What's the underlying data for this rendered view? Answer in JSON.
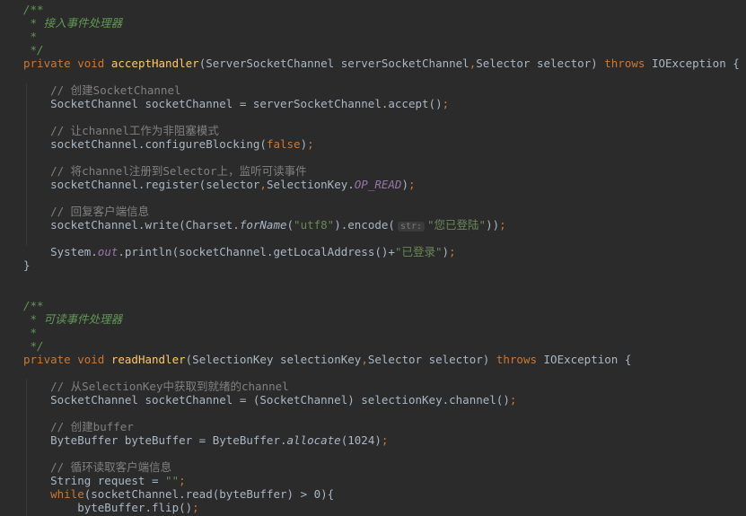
{
  "code": {
    "lines": [
      [
        {
          "t": "/**",
          "c": "doc"
        }
      ],
      [
        {
          "t": " * 接入事件处理器",
          "c": "doc"
        }
      ],
      [
        {
          "t": " *",
          "c": "doc"
        }
      ],
      [
        {
          "t": " */",
          "c": "doc"
        }
      ],
      [
        {
          "t": "private void ",
          "c": "kw"
        },
        {
          "t": "acceptHandler",
          "c": "fn"
        },
        {
          "t": "(ServerSocketChannel serverSocketChannel",
          "c": "p"
        },
        {
          "t": ",",
          "c": "kw"
        },
        {
          "t": "Selector selector) ",
          "c": "p"
        },
        {
          "t": "throws ",
          "c": "kw"
        },
        {
          "t": "IOException {",
          "c": "p"
        }
      ],
      [],
      [
        {
          "t": "    // 创建SocketChannel",
          "c": "cmt"
        }
      ],
      [
        {
          "t": "    SocketChannel socketChannel = serverSocketChannel.accept()",
          "c": "p"
        },
        {
          "t": ";",
          "c": "kw"
        }
      ],
      [],
      [
        {
          "t": "    // 让channel工作为非阻塞模式",
          "c": "cmt"
        }
      ],
      [
        {
          "t": "    socketChannel.configureBlocking(",
          "c": "p"
        },
        {
          "t": "false",
          "c": "kw"
        },
        {
          "t": ")",
          "c": "p"
        },
        {
          "t": ";",
          "c": "kw"
        }
      ],
      [],
      [
        {
          "t": "    // 将channel注册到Selector上，监听可读事件",
          "c": "cmt"
        }
      ],
      [
        {
          "t": "    socketChannel.register(selector",
          "c": "p"
        },
        {
          "t": ",",
          "c": "kw"
        },
        {
          "t": "SelectionKey.",
          "c": "p"
        },
        {
          "t": "OP_READ",
          "c": "st"
        },
        {
          "t": ")",
          "c": "p"
        },
        {
          "t": ";",
          "c": "kw"
        }
      ],
      [],
      [
        {
          "t": "    // 回复客户端信息",
          "c": "cmt"
        }
      ],
      [
        {
          "t": "    socketChannel.write(Charset.",
          "c": "p"
        },
        {
          "t": "forName",
          "c": "sm"
        },
        {
          "t": "(",
          "c": "p"
        },
        {
          "t": "\"utf8\"",
          "c": "str"
        },
        {
          "t": ").encode(",
          "c": "p"
        },
        {
          "t": "str:",
          "c": "hint"
        },
        {
          "t": "\"您已登陆\"",
          "c": "str"
        },
        {
          "t": "))",
          "c": "p"
        },
        {
          "t": ";",
          "c": "kw"
        }
      ],
      [],
      [
        {
          "t": "    System.",
          "c": "p"
        },
        {
          "t": "out",
          "c": "st"
        },
        {
          "t": ".println(socketChannel.getLocalAddress()+",
          "c": "p"
        },
        {
          "t": "\"已登录\"",
          "c": "str"
        },
        {
          "t": ")",
          "c": "p"
        },
        {
          "t": ";",
          "c": "kw"
        }
      ],
      [
        {
          "t": "}",
          "c": "p"
        }
      ],
      [],
      [],
      [
        {
          "t": "/**",
          "c": "doc"
        }
      ],
      [
        {
          "t": " * 可读事件处理器",
          "c": "doc"
        }
      ],
      [
        {
          "t": " *",
          "c": "doc"
        }
      ],
      [
        {
          "t": " */",
          "c": "doc"
        }
      ],
      [
        {
          "t": "private void ",
          "c": "kw"
        },
        {
          "t": "readHandler",
          "c": "fn"
        },
        {
          "t": "(SelectionKey selectionKey",
          "c": "p"
        },
        {
          "t": ",",
          "c": "kw"
        },
        {
          "t": "Selector selector) ",
          "c": "p"
        },
        {
          "t": "throws ",
          "c": "kw"
        },
        {
          "t": "IOException {",
          "c": "p"
        }
      ],
      [],
      [
        {
          "t": "    // 从SelectionKey中获取到就绪的channel",
          "c": "cmt"
        }
      ],
      [
        {
          "t": "    SocketChannel socketChannel = (SocketChannel) selectionKey.channel()",
          "c": "p"
        },
        {
          "t": ";",
          "c": "kw"
        }
      ],
      [],
      [
        {
          "t": "    // 创建buffer",
          "c": "cmt"
        }
      ],
      [
        {
          "t": "    ByteBuffer byteBuffer = ByteBuffer.",
          "c": "p"
        },
        {
          "t": "allocate",
          "c": "sm"
        },
        {
          "t": "(",
          "c": "p"
        },
        {
          "t": "1024",
          "c": "p"
        },
        {
          "t": ")",
          "c": "p"
        },
        {
          "t": ";",
          "c": "kw"
        }
      ],
      [],
      [
        {
          "t": "    // 循环读取客户端信息",
          "c": "cmt"
        }
      ],
      [
        {
          "t": "    String request = ",
          "c": "p"
        },
        {
          "t": "\"\"",
          "c": "str"
        },
        {
          "t": ";",
          "c": "kw"
        }
      ],
      [
        {
          "t": "    ",
          "c": "p"
        },
        {
          "t": "while",
          "c": "kw"
        },
        {
          "t": "(socketChannel.read(byteBuffer) > ",
          "c": "p"
        },
        {
          "t": "0",
          "c": "p"
        },
        {
          "t": "){",
          "c": "p"
        }
      ],
      [
        {
          "t": "        byteBuffer.flip()",
          "c": "p"
        },
        {
          "t": ";",
          "c": "kw"
        }
      ]
    ]
  }
}
